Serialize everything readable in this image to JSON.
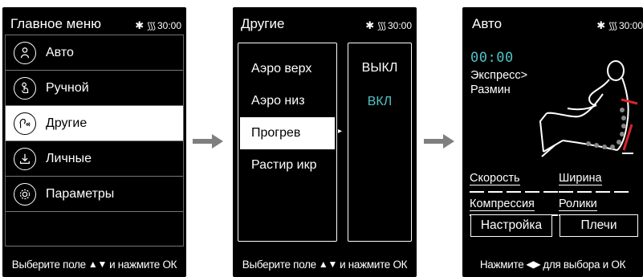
{
  "status": {
    "bluetooth_icon": "bluetooth-icon",
    "heat_icon": "heat-waves-icon",
    "time": "30:00"
  },
  "screen1": {
    "title": "Главное меню",
    "items": [
      {
        "label": "Авто",
        "icon": "person-silhouette-icon",
        "selected": false
      },
      {
        "label": "Ручной",
        "icon": "hand-tap-icon",
        "selected": false
      },
      {
        "label": "Другие",
        "icon": "head-waves-icon",
        "selected": true
      },
      {
        "label": "Личные",
        "icon": "download-tray-icon",
        "selected": false
      },
      {
        "label": "Параметры",
        "icon": "gear-icon",
        "selected": false
      }
    ],
    "footer_before": "Выберите поле",
    "footer_glyph": "▲▼",
    "footer_after": "и нажмите ОК"
  },
  "screen2": {
    "title": "Другие",
    "options": [
      {
        "label": "Аэро верх",
        "selected": false
      },
      {
        "label": "Аэро низ",
        "selected": false
      },
      {
        "label": "Прогрев",
        "selected": true
      },
      {
        "label": "Растир икр",
        "selected": false
      }
    ],
    "values": [
      {
        "label": "ВЫКЛ",
        "color": "#ffffff"
      },
      {
        "label": "ВКЛ",
        "color": "#4fc3c7"
      }
    ],
    "caret": "▸",
    "footer_before": "Выберите поле",
    "footer_glyph": "▲▼",
    "footer_after": "и нажмите ОК"
  },
  "screen3": {
    "title": "Авто",
    "timer": "00:00",
    "program_line1": "Экспресс>",
    "program_line2": "Размин",
    "params": {
      "speed": "Скорость",
      "width": "Ширина",
      "compression": "Компрессия",
      "rollers": "Ролики"
    },
    "buttons": {
      "settings": "Настройка",
      "shoulders": "Плечи"
    },
    "footer_before": "Нажмите",
    "footer_glyph": "◀▶",
    "footer_after": "для выбора и ОК"
  },
  "colors": {
    "accent": "#4fc3c7",
    "roller_red": "#d9252b",
    "arrow_gray": "#7f7f7f"
  }
}
